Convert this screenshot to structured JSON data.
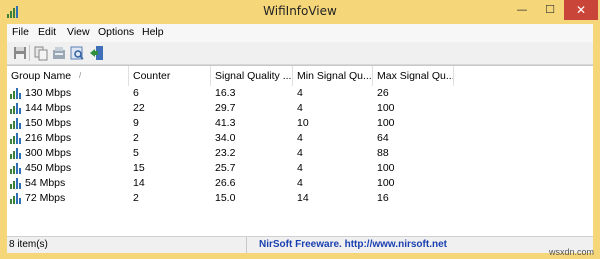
{
  "window": {
    "title": "WifiInfoView",
    "minimize_glyph": "—",
    "maximize_glyph": "☐",
    "close_glyph": "✕",
    "accent_color": "#f5d77a",
    "close_color": "#c9453a"
  },
  "menu": {
    "items": [
      "File",
      "Edit",
      "View",
      "Options",
      "Help"
    ]
  },
  "toolbar": {
    "icons": [
      "save-icon",
      "copy-icon",
      "html-report-icon",
      "properties-icon",
      "exit-icon"
    ]
  },
  "list": {
    "columns": [
      "Group Name",
      "Counter",
      "Signal Quality ...",
      "Min Signal Qu...",
      "Max Signal Qu..."
    ],
    "sort_indicator": "/",
    "rows": [
      {
        "name": "130 Mbps",
        "counter": "6",
        "quality": "16.3",
        "min": "4",
        "max": "26"
      },
      {
        "name": "144 Mbps",
        "counter": "22",
        "quality": "29.7",
        "min": "4",
        "max": "100"
      },
      {
        "name": "150 Mbps",
        "counter": "9",
        "quality": "41.3",
        "min": "10",
        "max": "100"
      },
      {
        "name": "216 Mbps",
        "counter": "2",
        "quality": "34.0",
        "min": "4",
        "max": "64"
      },
      {
        "name": "300 Mbps",
        "counter": "5",
        "quality": "23.2",
        "min": "4",
        "max": "88"
      },
      {
        "name": "450 Mbps",
        "counter": "15",
        "quality": "25.7",
        "min": "4",
        "max": "100"
      },
      {
        "name": "54 Mbps",
        "counter": "14",
        "quality": "26.6",
        "min": "4",
        "max": "100"
      },
      {
        "name": "72 Mbps",
        "counter": "2",
        "quality": "15.0",
        "min": "14",
        "max": "16"
      }
    ]
  },
  "status": {
    "count": "8 item(s)",
    "credit": "NirSoft Freeware.  http://www.nirsoft.net"
  },
  "watermark": "wsxdn.com"
}
